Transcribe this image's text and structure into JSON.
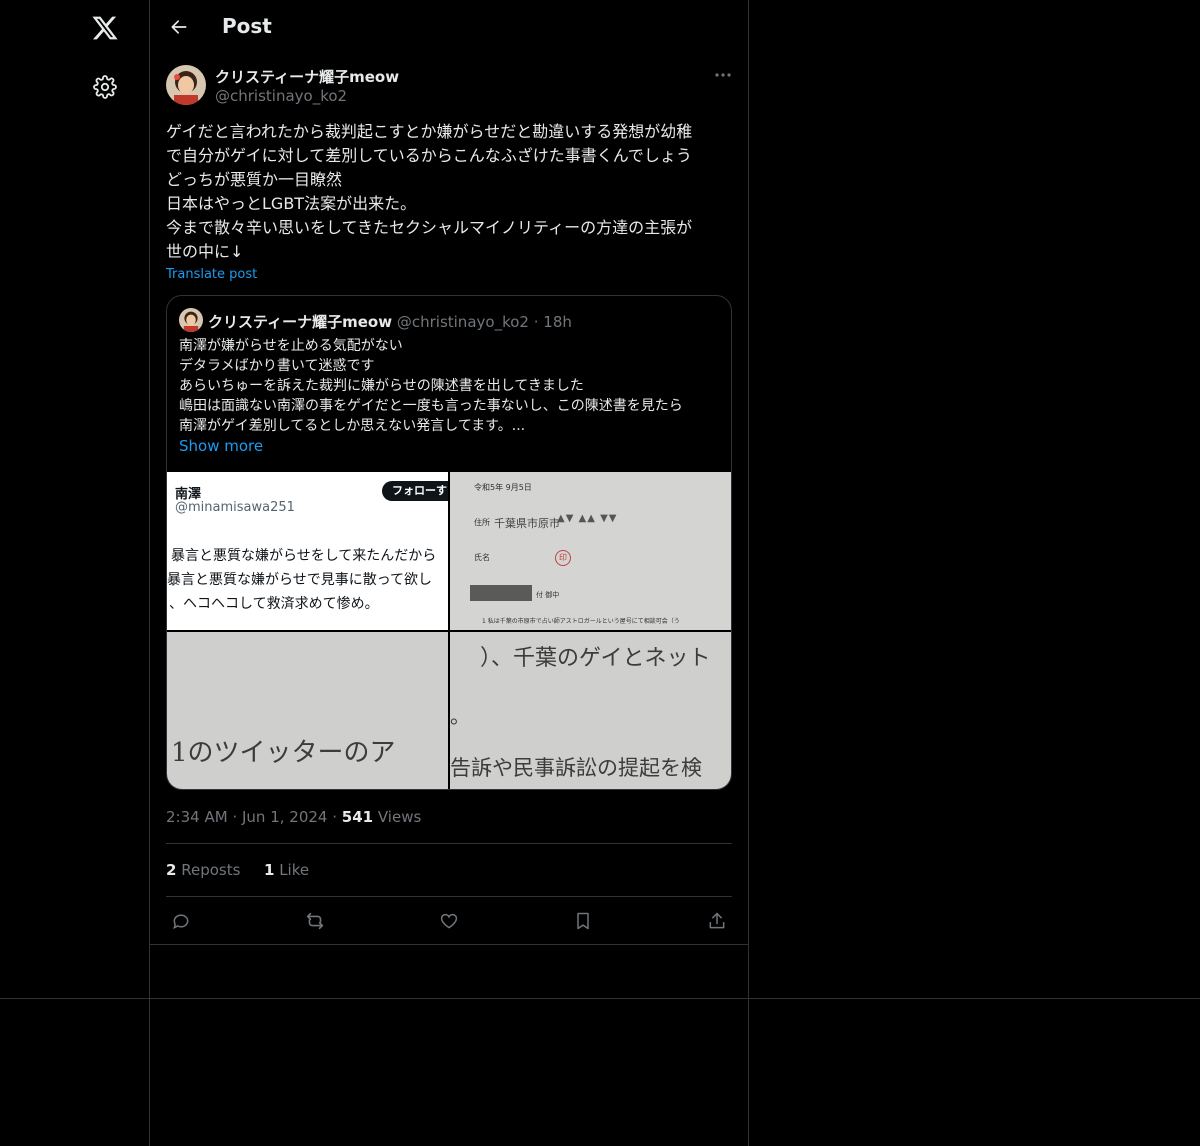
{
  "header": {
    "title": "Post"
  },
  "post": {
    "author_name": "クリスティーナ耀子meow",
    "author_handle": "@christinayo_ko2",
    "text": "ゲイだと言われたから裁判起こすとか嫌がらせだと勘違いする発想が幼稚\nで自分がゲイに対して差別しているからこんなふざけた事書くんでしょう\nどっちが悪質か一目瞭然\n日本はやっとLGBT法案が出来た。\n今まで散々辛い思いをしてきたセクシャルマイノリティーの方達の主張が\n世の中に↓",
    "translate_label": "Translate post",
    "time": "2:34 AM",
    "date": "Jun 1, 2024",
    "views_count": "541",
    "views_label": "Views",
    "reposts_count": "2",
    "reposts_label": "Reposts",
    "likes_count": "1",
    "likes_label": "Like"
  },
  "quote": {
    "author_name": "クリスティーナ耀子meow",
    "author_handle": "@christinayo_ko2",
    "age": "18h",
    "text": "南澤が嫌がらせを止める気配がない\nデタラメばかり書いて迷惑です\nあらいちゅーを訴えた裁判に嫌がらせの陳述書を出してきました\n嶋田は面識ない南澤の事をゲイだと一度も言った事ないし、この陳述書を見たら\n南澤がゲイ差別してるとしか思えない発言してます。...",
    "show_more": "Show more",
    "media": {
      "m1": {
        "name": "南澤",
        "handle": "@minamisawa251",
        "follow": "フォローす",
        "lines": [
          "暴言と悪質な嫌がらせをして来たんだから",
          "暴言と悪質な嫌がらせで見事に散って欲し",
          "、ヘコヘコして救済求めて惨め。"
        ]
      },
      "m2": {
        "date": "令和5年 9月5日",
        "addr_label": "住所",
        "addr_value": "千葉県市原市",
        "name_label": "氏名",
        "seal": "印",
        "addressee": "付 御中",
        "line1": "1 私は千葉の市原市で占い師アストロガールという屋号にて相談可会（う"
      },
      "m3": {
        "text": "1のツイッターのア"
      },
      "m4": {
        "line1": "）、千葉のゲイとネット",
        "line2": "。",
        "line3": "告訴や民事訴訟の提起を検"
      }
    }
  }
}
